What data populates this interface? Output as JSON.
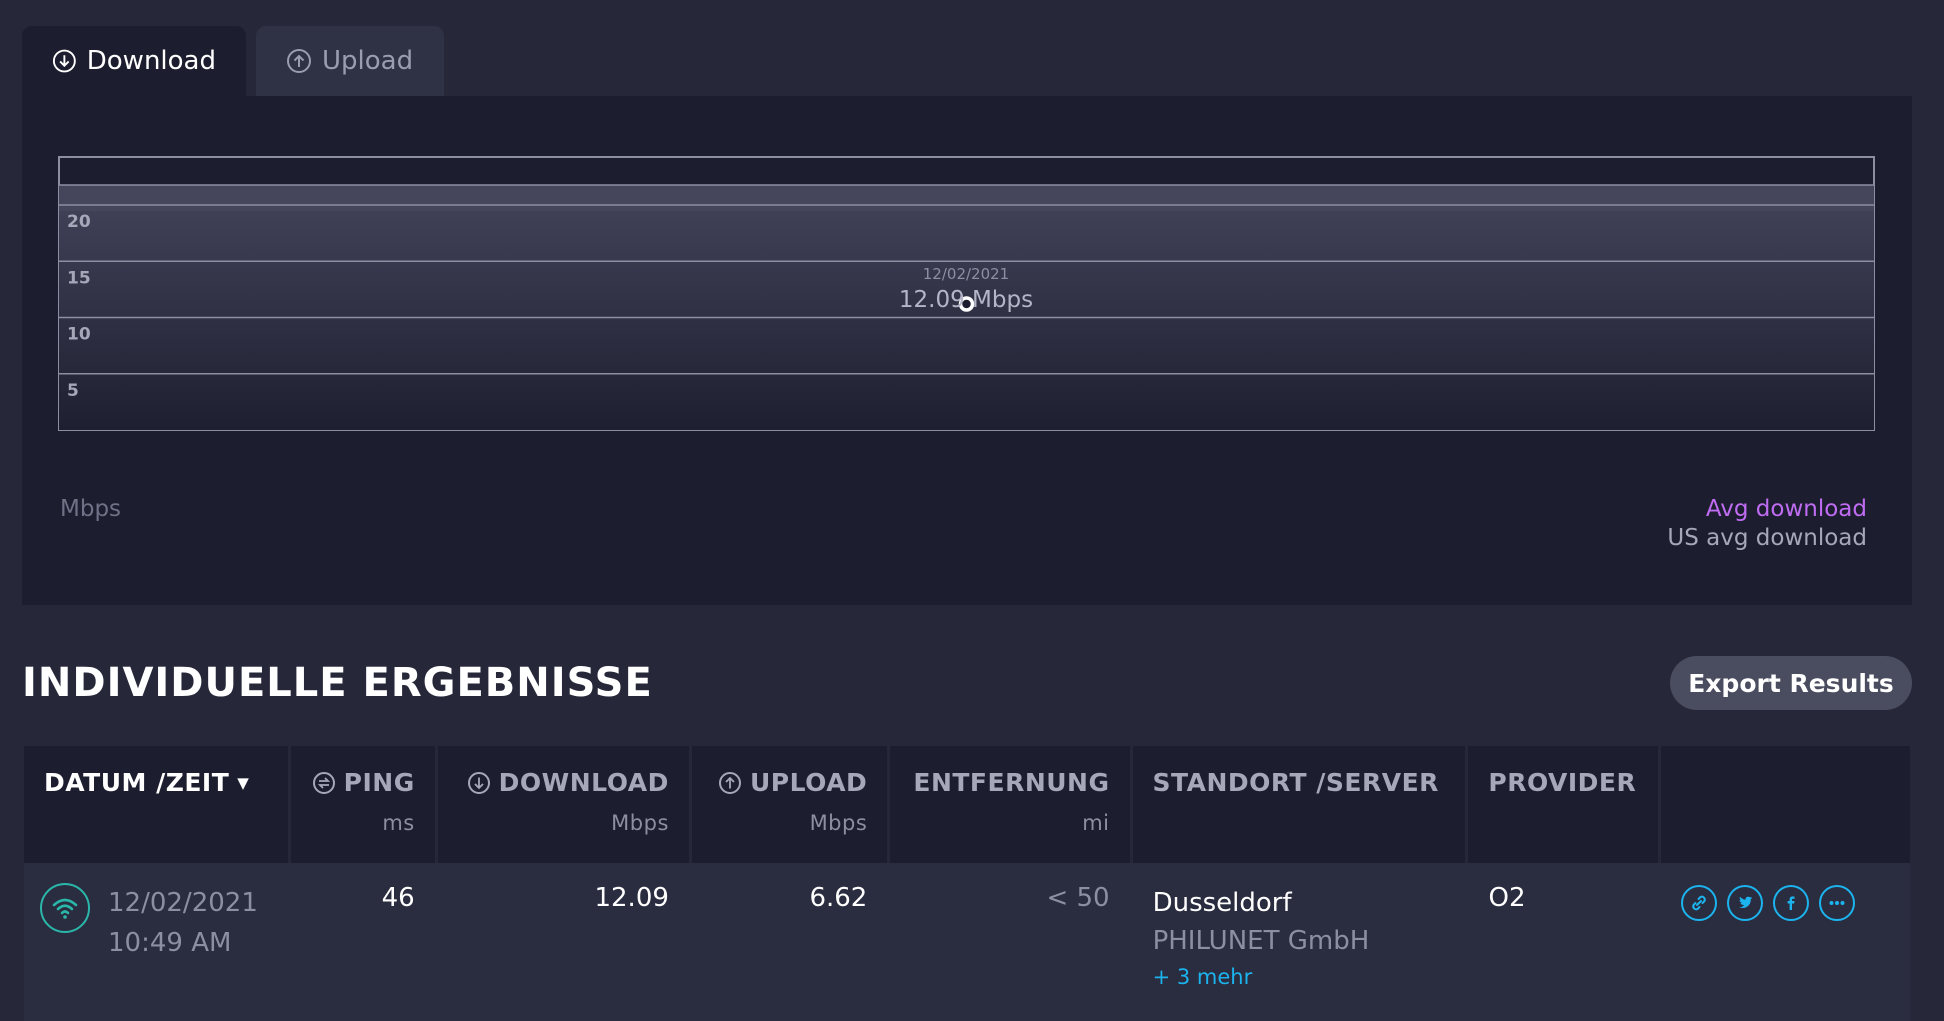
{
  "tabs": [
    {
      "label": "Download",
      "icon": "download-arrow-icon",
      "active": true
    },
    {
      "label": "Upload",
      "icon": "upload-arrow-icon",
      "active": false
    }
  ],
  "chart_data": {
    "type": "line",
    "y_ticks": [
      5,
      10,
      15,
      20
    ],
    "ylim": [
      0,
      24
    ],
    "ylabel": "Mbps",
    "series": [
      {
        "name": "Avg download",
        "color": "#bf6cf2",
        "points": [
          {
            "x": "12/02/2021",
            "y": 12.09
          }
        ]
      },
      {
        "name": "US avg download",
        "color": "#a6a8ba",
        "points": []
      }
    ],
    "tooltip": {
      "date": "12/02/2021",
      "value": "12.09 Mbps"
    }
  },
  "results": {
    "title": "INDIVIDUELLE ERGEBNISSE",
    "export_label": "Export Results",
    "columns": {
      "datetime": {
        "label": "DATUM /ZEIT",
        "sort_icon": "▼"
      },
      "ping": {
        "label": "PING",
        "unit": "ms"
      },
      "download": {
        "label": "DOWNLOAD",
        "unit": "Mbps"
      },
      "upload": {
        "label": "UPLOAD",
        "unit": "Mbps"
      },
      "distance": {
        "label": "ENTFERNUNG",
        "unit": "mi"
      },
      "server": {
        "label": "STANDORT /SERVER"
      },
      "provider": {
        "label": "PROVIDER"
      }
    },
    "rows": [
      {
        "date": "12/02/2021",
        "time": "10:49 AM",
        "ping": "46",
        "download": "12.09",
        "upload": "6.62",
        "distance": "< 50",
        "location": "Dusseldorf",
        "server": "PHILUNET GmbH",
        "more": "+ 3 mehr",
        "provider": "O2"
      }
    ]
  },
  "colors": {
    "background": "#26283a",
    "panel": "#1c1d2e",
    "accent_purple": "#bf6cf2",
    "accent_blue": "#1cb4ee",
    "wifi_teal": "#2ab7a9"
  }
}
